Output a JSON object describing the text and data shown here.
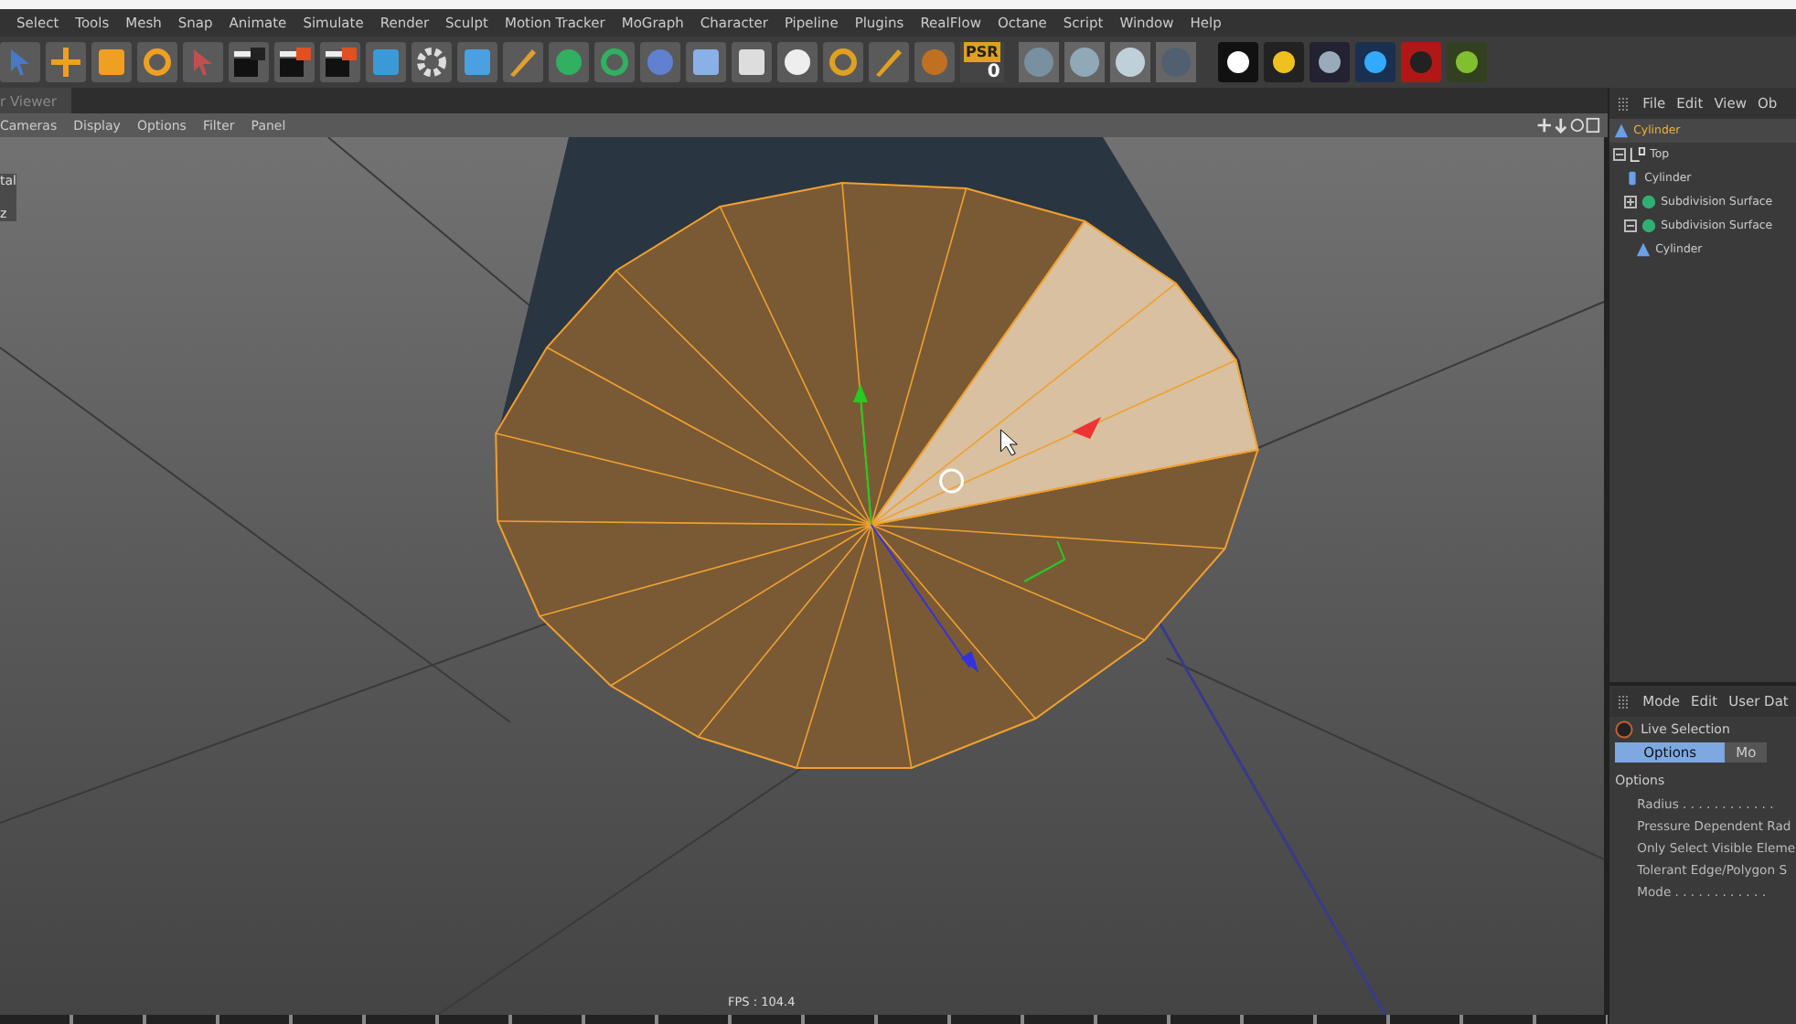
{
  "menu_bar": {
    "items": [
      "Select",
      "Tools",
      "Mesh",
      "Snap",
      "Animate",
      "Simulate",
      "Render",
      "Sculpt",
      "Motion Tracker",
      "MoGraph",
      "Character",
      "Pipeline",
      "Plugins",
      "RealFlow",
      "Octane",
      "Script",
      "Window",
      "Help"
    ]
  },
  "toolbar": {
    "psr_label": "PSR",
    "psr_value": "0"
  },
  "viewer_tab": {
    "label": "r Viewer"
  },
  "viewport": {
    "menu": [
      "Cameras",
      "Display",
      "Options",
      "Filter",
      "Panel"
    ],
    "side_texts": [
      "tal",
      "z"
    ],
    "fps": "FPS : 104.4"
  },
  "object_manager": {
    "menu": [
      "File",
      "Edit",
      "View",
      "Ob"
    ],
    "tree": [
      {
        "name": "Cylinder",
        "kind": "object",
        "selected": true
      },
      {
        "name": "Top",
        "kind": "null",
        "selected": false,
        "expanded": true,
        "children": [
          {
            "name": "Cylinder",
            "kind": "cylinder",
            "selected": false
          },
          {
            "name": "Subdivision Surface",
            "kind": "subdivision",
            "selected": false,
            "expanded": false
          },
          {
            "name": "Subdivision Surface",
            "kind": "subdivision",
            "selected": false,
            "expanded": true,
            "children": [
              {
                "name": "Cylinder",
                "kind": "object",
                "selected": false
              }
            ]
          }
        ]
      }
    ]
  },
  "attribute_manager": {
    "menu": [
      "Mode",
      "Edit",
      "User Dat"
    ],
    "tool": "Live Selection",
    "tabs": [
      {
        "label": "Options",
        "selected": true
      },
      {
        "label": "Mo",
        "selected": false
      }
    ],
    "section": "Options",
    "rows": [
      "Radius . . . . . . . . . . . .",
      "Pressure Dependent Rad",
      "Only Select Visible Eleme",
      "Tolerant Edge/Polygon S",
      "Mode . . . . . . . . . . . ."
    ]
  }
}
